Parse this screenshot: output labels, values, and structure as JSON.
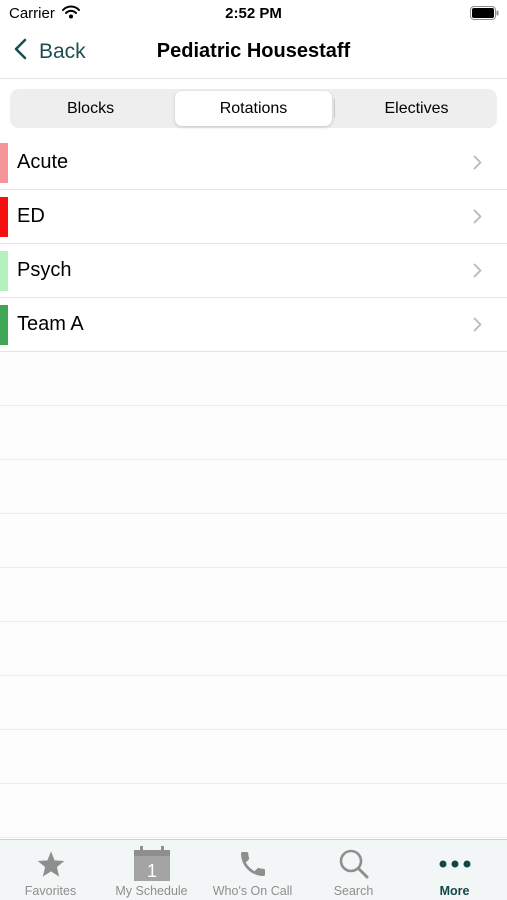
{
  "status_bar": {
    "carrier": "Carrier",
    "time": "2:52 PM"
  },
  "nav": {
    "back_label": "Back",
    "title": "Pediatric Housestaff"
  },
  "segments": [
    {
      "label": "Blocks",
      "active": false
    },
    {
      "label": "Rotations",
      "active": true
    },
    {
      "label": "Electives",
      "active": false
    }
  ],
  "rotations": [
    {
      "label": "Acute",
      "color": "#f4959a"
    },
    {
      "label": "ED",
      "color": "#f50f0f"
    },
    {
      "label": "Psych",
      "color": "#b2f2bf"
    },
    {
      "label": "Team A",
      "color": "#3fa655"
    }
  ],
  "tabbar": {
    "calendar_day": "1",
    "items": [
      {
        "label": "Favorites",
        "icon": "star-icon",
        "active": false
      },
      {
        "label": "My Schedule",
        "icon": "calendar-icon",
        "active": false
      },
      {
        "label": "Who's On Call",
        "icon": "phone-icon",
        "active": false
      },
      {
        "label": "Search",
        "icon": "search-icon",
        "active": false
      },
      {
        "label": "More",
        "icon": "more-icon",
        "active": true
      }
    ]
  },
  "colors": {
    "accent": "#124748",
    "inactive": "#8e8e8e"
  }
}
